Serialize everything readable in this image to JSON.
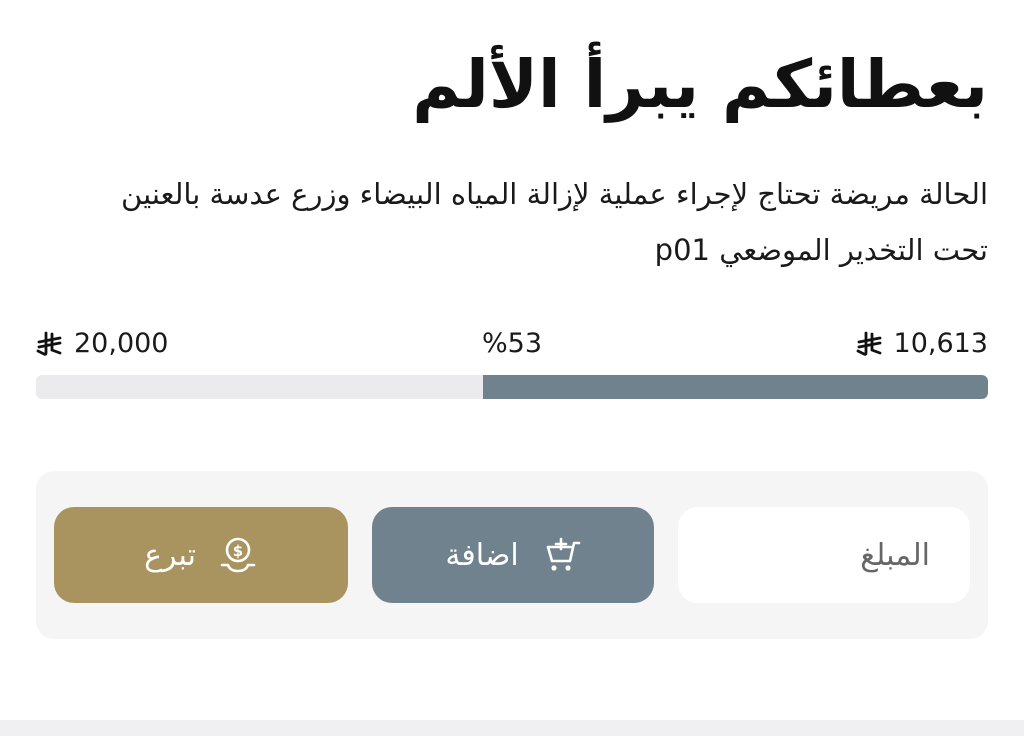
{
  "campaign": {
    "title": "بعطائكم يبرأ الألم",
    "description": "الحالة مريضة تحتاج لإجراء عملية لإزالة المياه البيضاء وزرع عدسة بالعنين تحت التخدير الموضعي p01"
  },
  "progress": {
    "goal": "20,000",
    "raised": "10,613",
    "percent_label": "%53",
    "fraction": 0.53,
    "currency_icon": "riyal-icon",
    "fill_color": "#71828f",
    "track_color": "#ebebee"
  },
  "actions": {
    "amount_placeholder": "المبلغ",
    "add_label": "اضافة",
    "add_icon": "cart-plus-icon",
    "add_color": "#71828f",
    "donate_label": "تبرع",
    "donate_icon": "donate-coin-hand-icon",
    "donate_color": "#a99460"
  }
}
